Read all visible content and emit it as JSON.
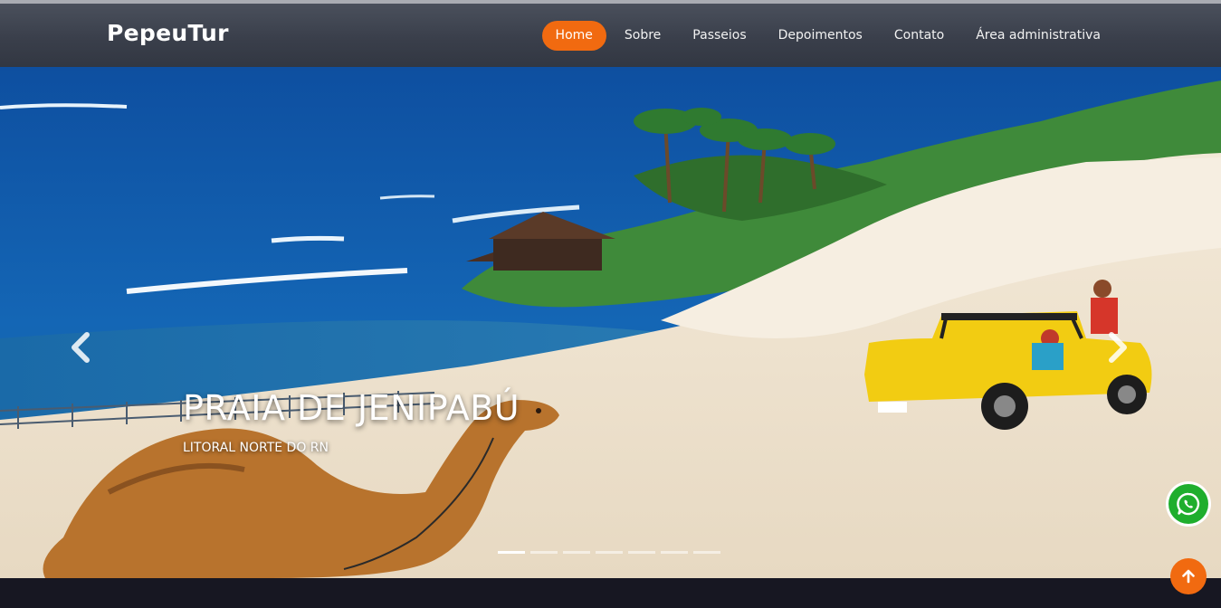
{
  "brand": "PepeuTur",
  "nav": {
    "items": [
      {
        "label": "Home"
      },
      {
        "label": "Sobre"
      },
      {
        "label": "Passeios"
      },
      {
        "label": "Depoimentos"
      },
      {
        "label": "Contato"
      },
      {
        "label": "Área administrativa"
      }
    ],
    "active_index": 0
  },
  "carousel": {
    "slide_title": "PRAIA DE JENIPABÚ",
    "slide_subtitle": "LITORAL NORTE DO RN",
    "slide_count": 7,
    "active_slide": 1,
    "prev_icon": "chevron-left-icon",
    "next_icon": "chevron-right-icon"
  },
  "floating": {
    "whatsapp_icon": "whatsapp-icon",
    "back_to_top_icon": "arrow-up-icon"
  },
  "colors": {
    "accent": "#f16a10",
    "navbar": "#3a3f4b",
    "whatsapp": "#1fae2d",
    "footer_band": "#171722"
  }
}
